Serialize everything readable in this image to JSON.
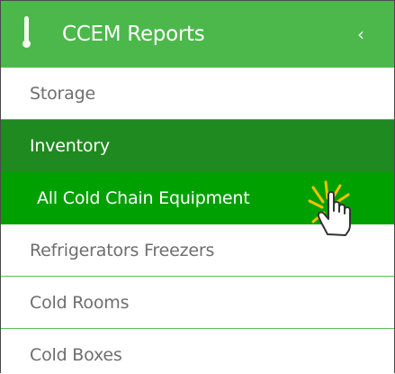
{
  "sidebar": {
    "title": "CCEM Reports",
    "collapse_glyph": "‹",
    "icon": "thermometer-icon",
    "items": [
      {
        "label": "Storage",
        "state": "normal"
      },
      {
        "label": "Inventory",
        "state": "section-header"
      },
      {
        "label": "All Cold Chain Equipment",
        "state": "hover"
      },
      {
        "label": "Refrigerators Freezers",
        "state": "normal"
      },
      {
        "label": "Cold Rooms",
        "state": "normal"
      },
      {
        "label": "Cold Boxes",
        "state": "normal"
      }
    ]
  },
  "colors": {
    "header_green": "#4cb84c",
    "section_green": "#1f8a1f",
    "active_green": "#00a000",
    "divider_green": "#58c058",
    "item_text": "#6e6e6e"
  },
  "cursor": {
    "type": "hand-pointer-icon",
    "click_burst": "yellow"
  }
}
